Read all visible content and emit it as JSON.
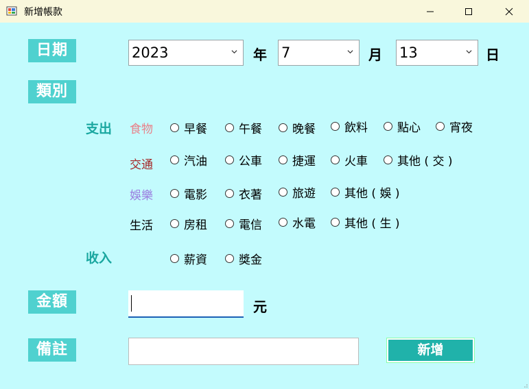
{
  "window": {
    "title": "新增帳款"
  },
  "labels": {
    "date": "日期",
    "category": "類別",
    "amount": "金額",
    "note": "備註"
  },
  "date": {
    "year": {
      "value": "2023"
    },
    "year_unit": "年",
    "month": {
      "value": "7"
    },
    "month_unit": "月",
    "day": {
      "value": "13"
    },
    "day_unit": "日"
  },
  "category": {
    "expense_label": "支出",
    "income_label": "收入",
    "subcats": {
      "food": {
        "label": "食物",
        "color": "#e8828a",
        "options": [
          "早餐",
          "午餐",
          "晚餐",
          "飲料",
          "點心",
          "宵夜"
        ]
      },
      "transport": {
        "label": "交通",
        "color": "#a52a2a",
        "options": [
          "汽油",
          "公車",
          "捷運",
          "火車",
          "其他 ( 交 )"
        ]
      },
      "entertainment": {
        "label": "娛樂",
        "color": "#9b7de0",
        "options": [
          "電影",
          "衣著",
          "旅遊",
          "其他 ( 娛 )"
        ]
      },
      "living": {
        "label": "生活",
        "color": "#000000",
        "options": [
          "房租",
          "電信",
          "水電",
          "其他 ( 生 )"
        ]
      }
    },
    "income_options": [
      "薪資",
      "獎金"
    ]
  },
  "amount": {
    "value": "",
    "unit": "元"
  },
  "note": {
    "value": ""
  },
  "submit_button": "新增"
}
